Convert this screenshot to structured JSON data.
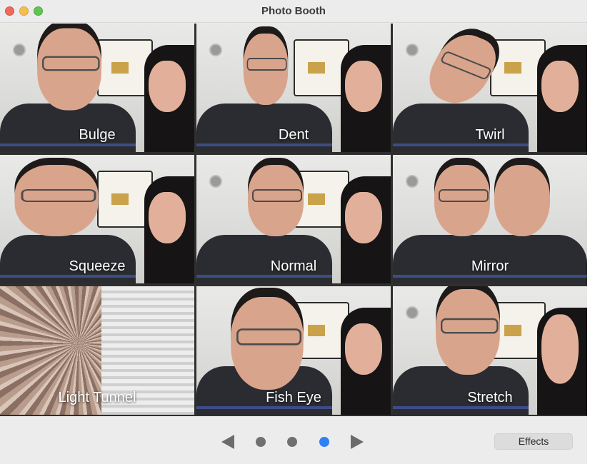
{
  "window": {
    "title": "Photo Booth"
  },
  "effects": [
    {
      "label": "Bulge"
    },
    {
      "label": "Dent"
    },
    {
      "label": "Twirl"
    },
    {
      "label": "Squeeze"
    },
    {
      "label": "Normal"
    },
    {
      "label": "Mirror"
    },
    {
      "label": "Light Tunnel"
    },
    {
      "label": "Fish Eye"
    },
    {
      "label": "Stretch"
    }
  ],
  "pager": {
    "page_count": 3,
    "current_page": 3
  },
  "toolbar": {
    "effects_label": "Effects"
  },
  "colors": {
    "page_dot_active": "#2f7ff5",
    "page_dot_inactive": "#707070",
    "close": "#ed6a5e",
    "minimize": "#f5bf4f",
    "maximize": "#61c554"
  },
  "icons": {
    "previous": "triangle-left",
    "next": "triangle-right",
    "window_controls": [
      "close-dot",
      "minimize-dot",
      "maximize-dot"
    ]
  }
}
